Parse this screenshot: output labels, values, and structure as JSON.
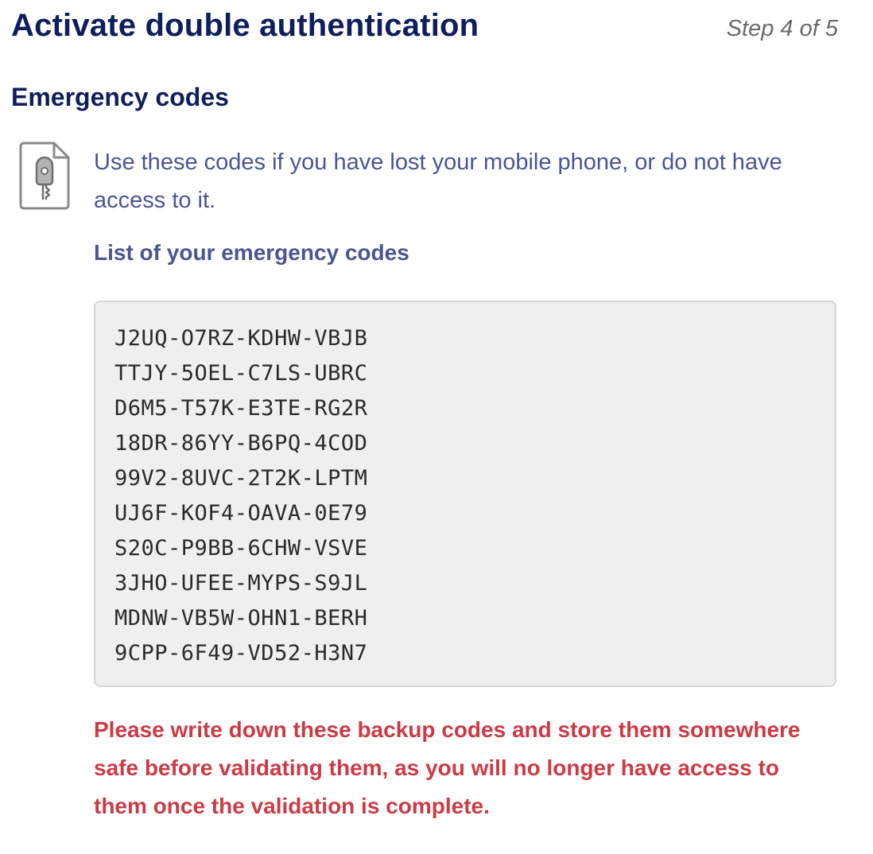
{
  "header": {
    "title": "Activate double authentication",
    "step": "Step 4 of 5"
  },
  "section": {
    "title": "Emergency codes",
    "icon": "document-key-icon",
    "description": "Use these codes if you have lost your mobile phone, or do not have access to it."
  },
  "codes": {
    "heading": "List of your emergency codes",
    "items": [
      "J2UQ-O7RZ-KDHW-VBJB",
      "TTJY-5OEL-C7LS-UBRC",
      "D6M5-T57K-E3TE-RG2R",
      "18DR-86YY-B6PQ-4COD",
      "99V2-8UVC-2T2K-LPTM",
      "UJ6F-KOF4-OAVA-0E79",
      "S20C-P9BB-6CHW-VSVE",
      "3JHO-UFEE-MYPS-S9JL",
      "MDNW-VB5W-OHN1-BERH",
      "9CPP-6F49-VD52-H3N7"
    ]
  },
  "warning": {
    "text": "Please write down these backup codes and store them somewhere safe before validating them, as you will no longer have access to them once the validation is complete."
  },
  "colors": {
    "title": "#0e1f5b",
    "body_text": "#4a5592",
    "warning": "#cc3b45",
    "codes_background": "#efefef"
  }
}
